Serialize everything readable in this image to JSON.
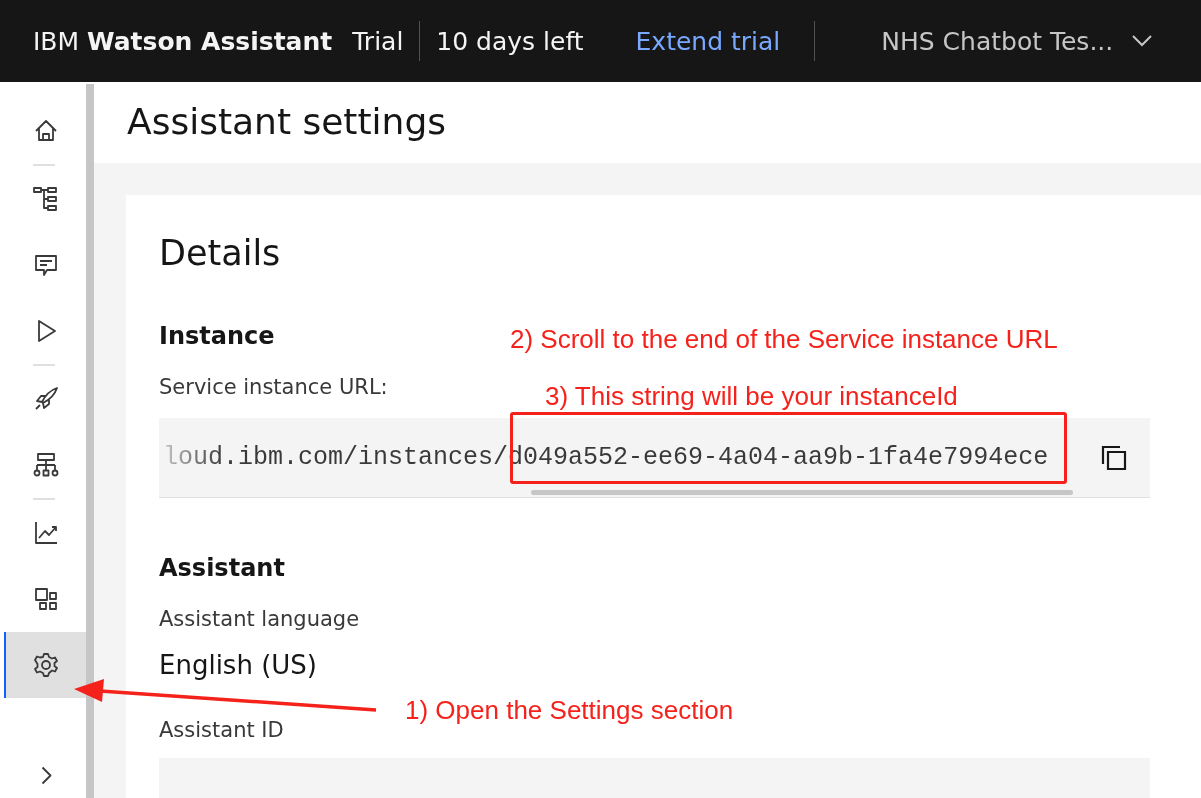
{
  "header": {
    "brand_prefix": "IBM",
    "brand_name": "Watson Assistant",
    "plan": "Trial",
    "days_left": "10 days left",
    "extend_link": "Extend trial",
    "instance_menu": "NHS Chatbot Tes..."
  },
  "sidebar": {
    "items": [
      {
        "kind": "home",
        "selected": false
      },
      {
        "kind": "tree",
        "selected": false
      },
      {
        "kind": "chat",
        "selected": false
      },
      {
        "kind": "play",
        "selected": false
      },
      {
        "kind": "rocket",
        "selected": false
      },
      {
        "kind": "hierarchy",
        "selected": false
      },
      {
        "kind": "chart",
        "selected": false
      },
      {
        "kind": "widgets",
        "selected": false
      },
      {
        "kind": "settings",
        "selected": true
      },
      {
        "kind": "expand",
        "selected": false
      }
    ]
  },
  "page": {
    "title": "Assistant settings",
    "section": "Details",
    "instance": {
      "heading": "Instance",
      "url_label": "Service instance URL:",
      "url_value": "loud.ibm.com/instances/d049a552-ee69-4a04-aa9b-1fa4e7994ece"
    },
    "assistant": {
      "heading": "Assistant",
      "language_label": "Assistant language",
      "language_value": "English (US)",
      "id_label": "Assistant ID"
    }
  },
  "annotations": [
    {
      "text": "2) Scroll to the end of the Service instance URL"
    },
    {
      "text": "3) This string will be your instanceId"
    },
    {
      "text": "1) Open the Settings section"
    }
  ]
}
